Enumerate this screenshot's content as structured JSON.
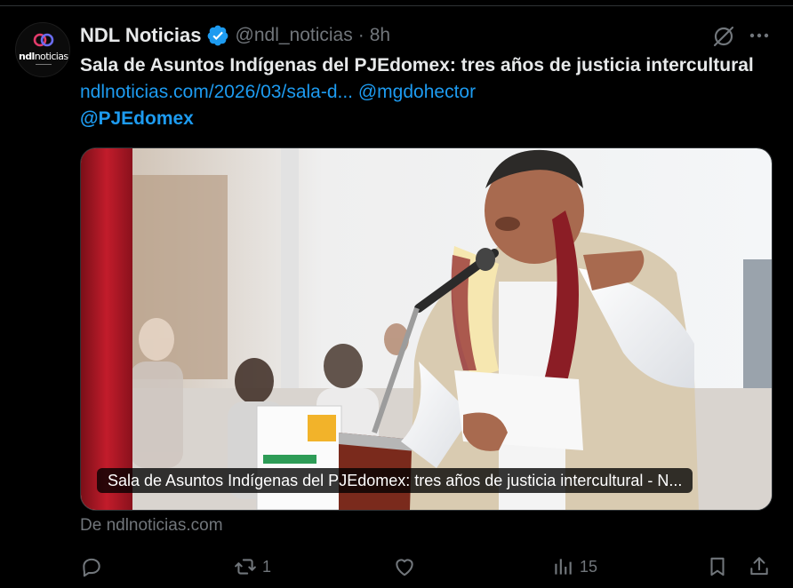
{
  "account": {
    "name": "NDL Noticias",
    "handle": "@ndl_noticias",
    "separator": "·",
    "time": "8h",
    "avatar_brand_bold": "ndl",
    "avatar_brand_rest": "noticias"
  },
  "tweet": {
    "title": "Sala de Asuntos Indígenas del PJEdomex: tres años de justicia intercultural",
    "link": "ndlnoticias.com/2026/03/sala-d...",
    "mention1": "@mgdohector",
    "mention2": "@PJEdomex"
  },
  "card": {
    "caption": "Sala de Asuntos Indígenas del PJEdomex: tres años de justicia intercultural - N...",
    "source": "De ndlnoticias.com"
  },
  "actions": {
    "reply_count": "",
    "retweet_count": "1",
    "like_count": "",
    "views_count": "15"
  },
  "colors": {
    "background": "#000000",
    "text": "#e7e9ea",
    "muted": "#71767b",
    "link": "#1d9bf0",
    "verified": "#1d9bf0"
  },
  "icons": [
    "grok-icon",
    "more-icon",
    "verified-icon",
    "reply-icon",
    "retweet-icon",
    "like-icon",
    "views-icon",
    "bookmark-icon",
    "share-icon"
  ]
}
